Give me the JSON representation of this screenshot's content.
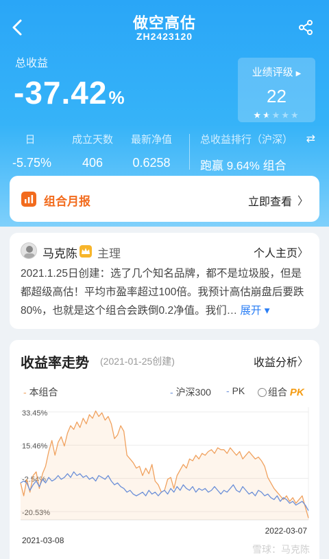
{
  "header": {
    "title": "做空高估",
    "code": "ZH2423120"
  },
  "summary": {
    "total_label": "总收益",
    "total_value": "-37.42",
    "total_unit": "%"
  },
  "rating": {
    "label": "业绩评级",
    "score": "22",
    "stars_filled": 1.5,
    "stars_total": 5
  },
  "stats": [
    {
      "label": "日",
      "value": "-5.75%"
    },
    {
      "label": "成立天数",
      "value": "406"
    },
    {
      "label": "最新净值",
      "value": "0.6258"
    }
  ],
  "ranking": {
    "label": "总收益排行（沪深）",
    "value": "跑赢 9.64% 组合"
  },
  "report": {
    "title": "组合月报",
    "link": "立即查看"
  },
  "manager": {
    "name": "马克陈",
    "role": "主理",
    "link": "个人主页",
    "description": "2021.1.25日创建：选了几个知名品牌，都不是垃圾股，但是都超级高估！平均市盈率超过100倍。我预计高估崩盘后要跌80%，也就是这个组合会跌倒0.2净值。我们…",
    "expand": "展开"
  },
  "chart_section": {
    "title": "收益率走势",
    "created": "(2021-01-25创建)",
    "link": "收益分析",
    "legend": {
      "self": "本组合",
      "index": "沪深300",
      "pk": "PK",
      "pk_option": "组合",
      "pk_logo": "PK"
    }
  },
  "colors": {
    "self": "#f0a15e",
    "index": "#6b8fd8",
    "accent": "#f26b1d"
  },
  "chart_data": {
    "type": "line",
    "yticks": [
      "33.45%",
      "15.46%",
      "-2.54%",
      "-20.53%"
    ],
    "ylim": [
      -25,
      36
    ],
    "x_start": "2021-03-08",
    "x_end": "2022-03-07",
    "series": [
      {
        "name": "本组合",
        "values": [
          -5,
          -12,
          -3,
          -10,
          -1,
          1,
          -8,
          0,
          4,
          12,
          18,
          10,
          17,
          20,
          15,
          22,
          26,
          24,
          28,
          25,
          30,
          27,
          32,
          30,
          34,
          31,
          33,
          29,
          31,
          27,
          19,
          21,
          26,
          23,
          10,
          8,
          6,
          3,
          4,
          -1,
          3,
          0,
          5,
          -4,
          -6,
          -10,
          -9,
          -3,
          -2,
          -8,
          -1,
          2,
          5,
          3,
          8,
          7,
          10,
          8,
          11,
          10,
          12,
          13,
          11,
          14,
          13,
          13,
          11,
          14,
          12,
          10,
          12,
          8,
          10,
          12,
          10,
          8,
          9,
          7,
          4,
          -2,
          -5,
          -8,
          -10,
          -12,
          -14,
          -12,
          -15,
          -13,
          -16,
          -14,
          -12,
          -18,
          -24
        ]
      },
      {
        "name": "沪深300",
        "values": [
          -5,
          -4,
          -5,
          -9,
          -6,
          -4,
          -7,
          -3,
          -5,
          -2,
          -4,
          -3,
          -1,
          -3,
          -2,
          0,
          -2,
          1,
          -1,
          0,
          -2,
          -1,
          -3,
          -2,
          -4,
          -1,
          -2,
          -3,
          -1,
          -4,
          -6,
          -5,
          -7,
          -8,
          -10,
          -9,
          -11,
          -12,
          -11,
          -10,
          -12,
          -9,
          -11,
          -10,
          -12,
          -10,
          -9,
          -11,
          -8,
          -10,
          -7,
          -9,
          -6,
          -8,
          -9,
          -7,
          -10,
          -8,
          -9,
          -8,
          -10,
          -9,
          -7,
          -9,
          -11,
          -9,
          -10,
          -8,
          -6,
          -9,
          -10,
          -7,
          -9,
          -11,
          -10,
          -12,
          -9,
          -10,
          -12,
          -11,
          -13,
          -14,
          -12,
          -15,
          -13,
          -14,
          -16,
          -15,
          -17,
          -16,
          -15,
          -17,
          -20
        ]
      }
    ]
  },
  "watermark": "雪球：马克陈"
}
